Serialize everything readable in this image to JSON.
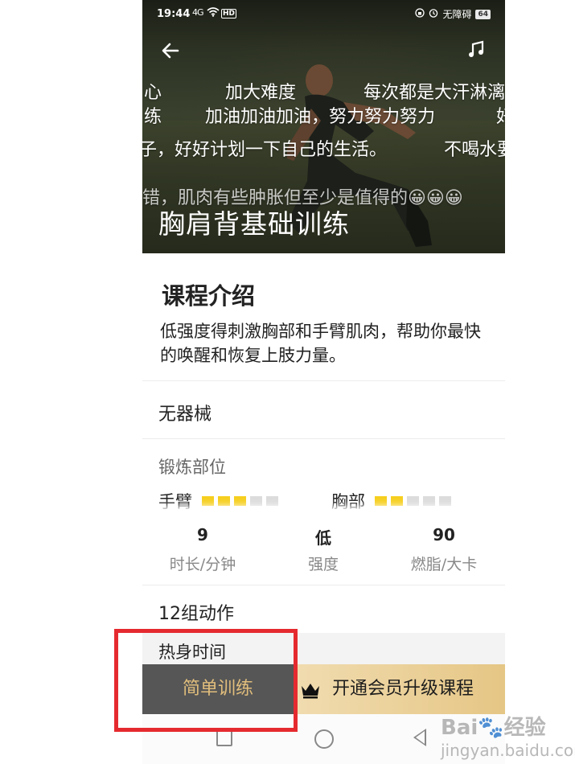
{
  "status_bar": {
    "time": "19:44",
    "signal": "4G",
    "hd": "HD",
    "dnd": "无障碍",
    "battery": "64"
  },
  "hero": {
    "title": "胸肩背基础训练",
    "danmaku": [
      "心",
      "加大难度",
      "每次都是大汗淋漓",
      "练",
      "加油加油加油，努力努力努力",
      "好",
      "子，好好计划一下自己的生活。",
      "不喝水要",
      "错，肌肉有些肿胀但至少是值得的😀😀😀"
    ]
  },
  "intro": {
    "title": "课程介绍",
    "text": "低强度得刺激胸部和手臂肌肉，帮助你最快的唤醒和恢复上肢力量。"
  },
  "equipment": "无器械",
  "target_parts": {
    "title": "锻炼部位",
    "parts": [
      {
        "label": "手臂",
        "level": 3,
        "max": 5
      },
      {
        "label": "胸部",
        "level": 2,
        "max": 5
      }
    ]
  },
  "stats": [
    {
      "value": "9",
      "label": "时长/分钟"
    },
    {
      "value": "低",
      "label": "强度"
    },
    {
      "value": "90",
      "label": "燃脂/大卡"
    }
  ],
  "actions_count": "12组动作",
  "warmup_title": "热身时间",
  "buttons": {
    "simple_training": "简单训练",
    "vip_upgrade": "开通会员升级课程"
  },
  "colors": {
    "accent_gold": "#e1be7c",
    "level_on": "#f6cf1f",
    "highlight": "#e52a2f"
  },
  "icons": {
    "back": "arrow-left-icon",
    "music": "music-note-icon",
    "crown": "crown-icon"
  },
  "watermark": {
    "brand": "Bai",
    "text": "经验",
    "sub": "jingyan.baidu.com"
  }
}
